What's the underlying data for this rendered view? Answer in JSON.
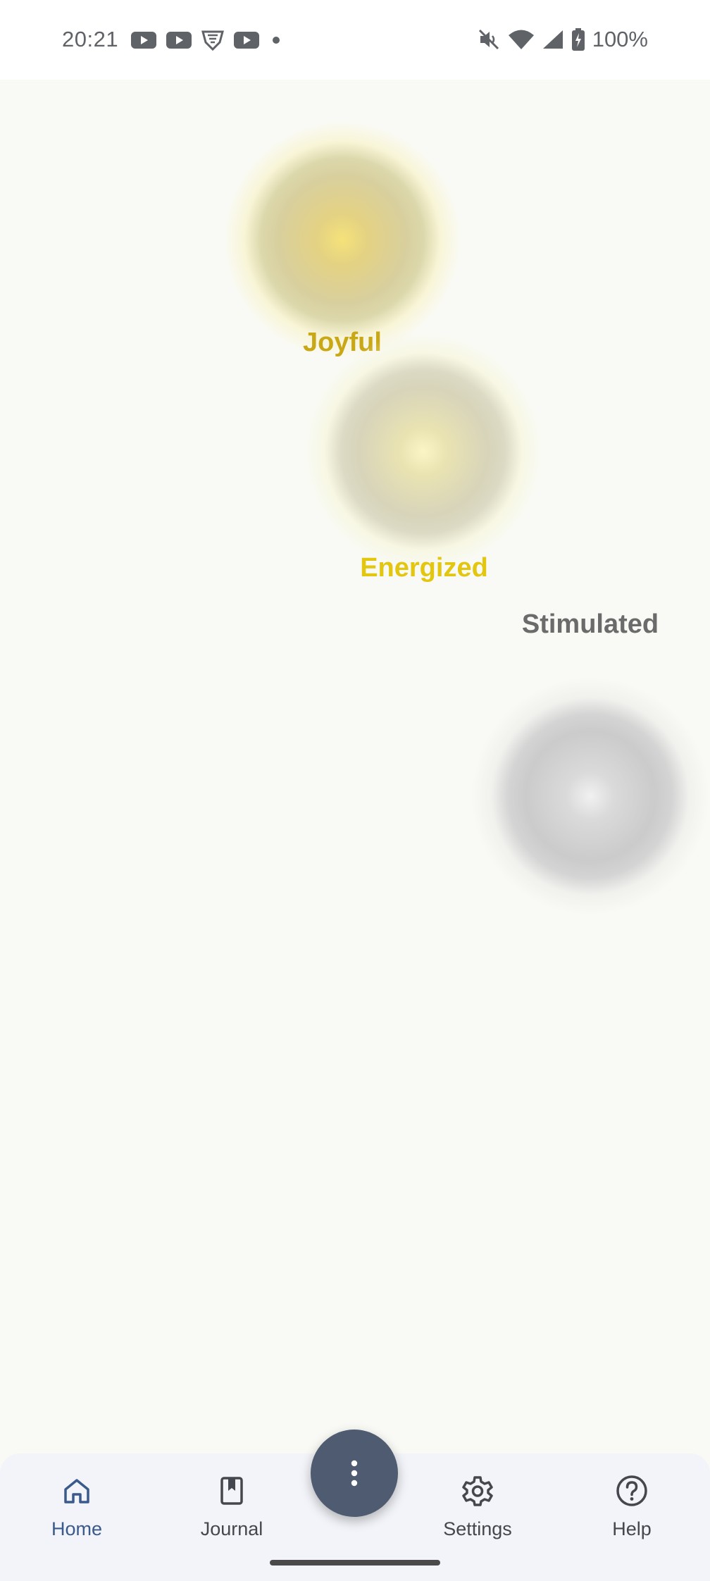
{
  "status_bar": {
    "time": "20:21",
    "notification_icons": [
      "youtube-icon",
      "youtube-icon",
      "vpn-shield-icon",
      "youtube-icon",
      "dot-icon"
    ],
    "battery": "100%"
  },
  "moods": [
    {
      "label": "Joyful",
      "color": "#c9a817"
    },
    {
      "label": "Energized",
      "color": "#e3c60f"
    },
    {
      "label": "Stimulated",
      "color": "#6b6b6b"
    }
  ],
  "nav": {
    "home": "Home",
    "journal": "Journal",
    "settings": "Settings",
    "help": "Help"
  },
  "colors": {
    "accent": "#3a5a8c",
    "fab": "#4f5b70",
    "background": "#f9faf5"
  }
}
